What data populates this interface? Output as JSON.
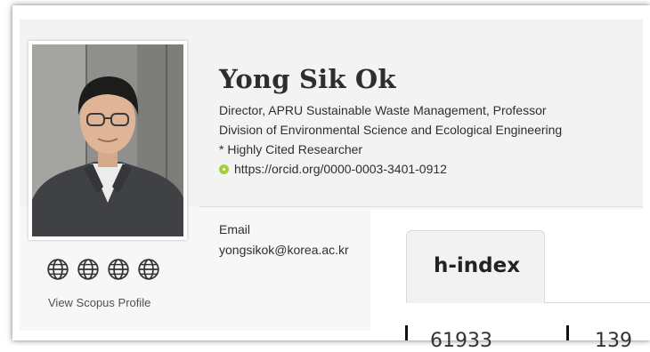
{
  "profile": {
    "name": "Yong Sik Ok",
    "title": "Director, APRU Sustainable Waste Management, Professor",
    "department": "Division of Environmental Science and Ecological Engineering",
    "badge": "* Highly Cited Researcher",
    "orcid_url": "https://orcid.org/0000-0003-3401-0912"
  },
  "contact": {
    "email_label": "Email",
    "email": "yongsikok@korea.ac.kr"
  },
  "links": {
    "globe_icons": [
      "globe-icon",
      "globe-icon",
      "globe-icon",
      "globe-icon"
    ],
    "scopus_label": "View Scopus Profile"
  },
  "metrics": {
    "tab_label": "h-index",
    "partial_values": [
      "61933",
      "139"
    ]
  },
  "colors": {
    "orcid_green": "#a6ce39",
    "header_bg": "#f3f3f3",
    "text": "#2e2e2e"
  }
}
